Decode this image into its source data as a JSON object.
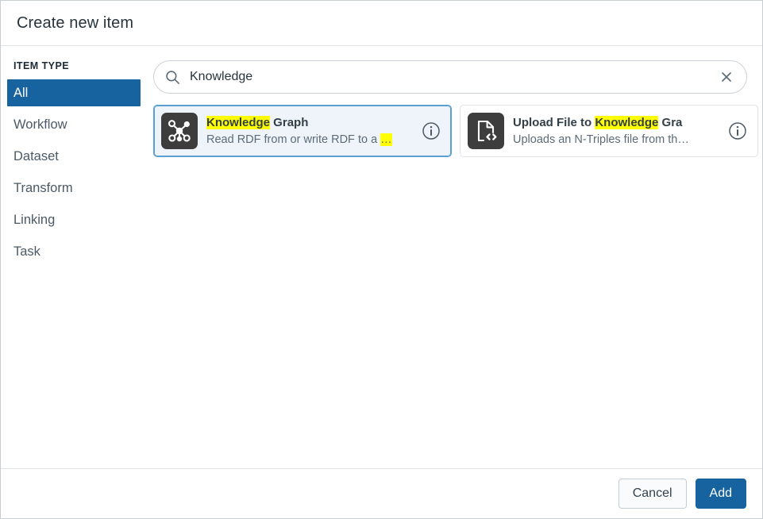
{
  "dialog": {
    "title": "Create new item"
  },
  "sidebar": {
    "heading": "ITEM TYPE",
    "items": [
      {
        "label": "All",
        "selected": true
      },
      {
        "label": "Workflow",
        "selected": false
      },
      {
        "label": "Dataset",
        "selected": false
      },
      {
        "label": "Transform",
        "selected": false
      },
      {
        "label": "Linking",
        "selected": false
      },
      {
        "label": "Task",
        "selected": false
      }
    ]
  },
  "search": {
    "value": "Knowledge",
    "placeholder": "Search",
    "search_icon": "search-icon",
    "clear_icon": "close-icon"
  },
  "results": [
    {
      "icon": "knowledge-graph-icon",
      "title_parts": [
        {
          "text": "Knowledge",
          "highlight": true
        },
        {
          "text": " Graph",
          "highlight": false
        }
      ],
      "title_plain": "Knowledge Graph",
      "desc_parts": [
        {
          "text": "Read RDF from or write RDF to a ",
          "highlight": false
        },
        {
          "text": "…",
          "highlight": true
        }
      ],
      "desc_plain": "Read RDF from or write RDF to a …",
      "info_icon": "info-icon",
      "selected": true
    },
    {
      "icon": "file-code-icon",
      "title_parts": [
        {
          "text": "Upload File to ",
          "highlight": false
        },
        {
          "text": "Knowledge",
          "highlight": true
        },
        {
          "text": " Gra",
          "highlight": false
        }
      ],
      "title_plain": "Upload File to Knowledge Gra",
      "desc_parts": [
        {
          "text": "Uploads an N-Triples file from th…",
          "highlight": false
        }
      ],
      "desc_plain": "Uploads an N-Triples file from th…",
      "info_icon": "info-icon",
      "selected": false
    }
  ],
  "footer": {
    "cancel_label": "Cancel",
    "add_label": "Add"
  },
  "colors": {
    "accent": "#16639f",
    "highlight": "#ffff00",
    "selected_card_bg": "#eef4fa",
    "selected_card_border": "#5a9fd4",
    "icon_tile_bg": "#3d3d3d",
    "text_primary": "#27343d",
    "text_secondary": "#5c6b77"
  }
}
